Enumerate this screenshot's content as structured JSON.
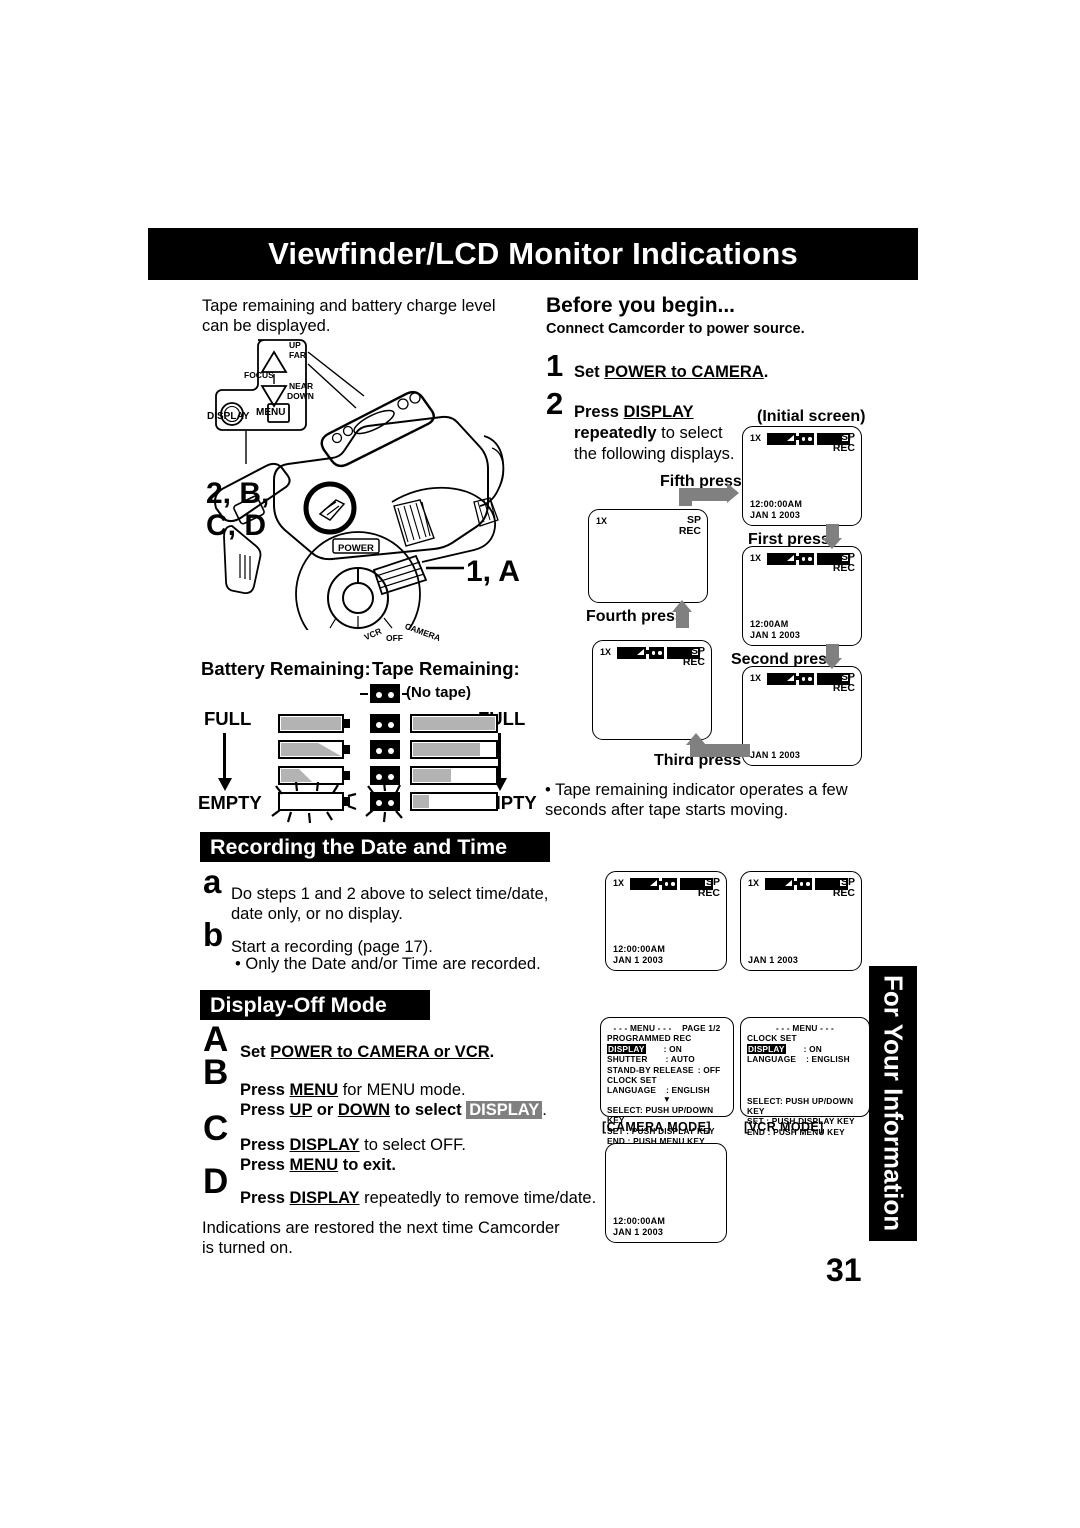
{
  "header": {
    "title": "Viewfinder/LCD Monitor Indications"
  },
  "intro": {
    "text": "Tape remaining and battery charge level can be displayed."
  },
  "before_you_begin": {
    "title": "Before you begin...",
    "subtitle": "Connect Camcorder to power source."
  },
  "steps": [
    {
      "num": "1",
      "lead": "Set ",
      "link": "POWER to CAMERA",
      "tail": "."
    },
    {
      "num": "2",
      "lead": "Press ",
      "link": "DISPLAY",
      "tail": "",
      "line2_bold": "repeatedly",
      "line2_rest": " to select",
      "line3": "the following displays."
    }
  ],
  "flow": {
    "initial_label": "(Initial screen)",
    "press_labels": {
      "first": "First press",
      "second": "Second press",
      "third": "Third press",
      "fourth": "Fourth press",
      "fifth": "Fifth press"
    },
    "screens": {
      "initial": {
        "zoom": "1X",
        "mode": "SP",
        "rec": "REC",
        "time": "12:00:00AM",
        "date": "JAN   1 2003",
        "icons": true
      },
      "first": {
        "zoom": "1X",
        "mode": "SP",
        "rec": "REC",
        "time": "12:00AM",
        "date": "JAN   1 2003",
        "icons": true
      },
      "second": {
        "zoom": "1X",
        "mode": "SP",
        "rec": "REC",
        "time": "",
        "date": "JAN   1 2003",
        "icons": true
      },
      "third": {
        "zoom": "1X",
        "mode": "SP",
        "rec": "REC",
        "time": "",
        "date": "",
        "icons": true
      },
      "fourth": {
        "zoom": "1X",
        "mode": "SP",
        "rec": "REC",
        "time": "",
        "date": "",
        "icons": false
      }
    }
  },
  "tape_note": "• Tape remaining indicator operates a few seconds after tape starts moving.",
  "camcorder": {
    "callout_left": "2, B,",
    "callout_left2": "C, D",
    "callout_right": "1, A",
    "controls": {
      "up": "UP",
      "far": "FAR",
      "focus": "FOCUS",
      "near": "NEAR",
      "down": "DOWN",
      "display": "DISPLAY",
      "menu": "MENU",
      "power": "POWER",
      "vcr": "VCR",
      "off": "OFF",
      "camera": "CAMERA"
    }
  },
  "remaining": {
    "battery_title": "Battery Remaining:",
    "tape_title": "Tape Remaining:",
    "no_tape": "(No tape)",
    "full_left": "FULL",
    "empty_left": "EMPTY",
    "full_right": "FULL",
    "empty_right": "EMPTY",
    "battery_levels": [
      100,
      62,
      30,
      0
    ],
    "tape_levels": [
      100,
      82,
      46,
      18,
      0
    ]
  },
  "recording_section": {
    "title": "Recording the Date and Time",
    "items": [
      {
        "letter": "a",
        "text": "Do steps 1 and 2 above to select time/date, date only, or no display."
      },
      {
        "letter": "b",
        "text": "Start a recording (page 17).",
        "bullet": "• Only the Date and/or Time are recorded."
      }
    ]
  },
  "display_off_section": {
    "title": "Display-Off Mode",
    "items": [
      {
        "letter": "A",
        "lead": "Set ",
        "link": "POWER to CAMERA or VCR",
        "tail": "."
      },
      {
        "letter": "B",
        "line1_lead": "Press ",
        "line1_link": "MENU",
        "line1_tail": " for MENU mode.",
        "line2_lead": "Press ",
        "line2_link1": "UP",
        "line2_mid": " or ",
        "line2_link2": "DOWN",
        "line2_tail": " to select ",
        "line2_box": "DISPLAY",
        "line2_end": "."
      },
      {
        "letter": "C",
        "line1_lead": "Press ",
        "line1_link": "DISPLAY",
        "line1_tail": " to select OFF.",
        "line2_lead": "Press ",
        "line2_link": "MENU",
        "line2_tail": " to exit."
      },
      {
        "letter": "D",
        "lead": "Press ",
        "link": "DISPLAY",
        "tail": " repeatedly to remove time/date."
      }
    ],
    "footnote": "Indications are restored the next time Camcorder is turned on."
  },
  "date_screens": [
    {
      "zoom": "1X",
      "mode": "SP",
      "rec": "REC",
      "time": "12:00:00AM",
      "date": "JAN   1 2003"
    },
    {
      "zoom": "1X",
      "mode": "SP",
      "rec": "REC",
      "time": "",
      "date": "JAN   1 2003"
    }
  ],
  "bottom_screen": {
    "time": "12:00:00AM",
    "date": "JAN   1 2003"
  },
  "menus": {
    "camera": {
      "title": "- - -  MENU  - - -",
      "page": "PAGE 1/2",
      "rows": [
        {
          "label": "PROGRAMMED  REC",
          "value": "",
          "selected": false
        },
        {
          "label": "DISPLAY",
          "value": ":  ON",
          "selected": true
        },
        {
          "label": "SHUTTER",
          "value": ":  AUTO",
          "selected": false
        },
        {
          "label": "STAND-BY RELEASE",
          "value": ":  OFF",
          "selected": false
        },
        {
          "label": "CLOCK SET",
          "value": "",
          "selected": false
        },
        {
          "label": "LANGUAGE",
          "value": ":  ENGLISH",
          "selected": false
        }
      ],
      "footer": [
        "SELECT: PUSH UP/DOWN KEY",
        "SET      :  PUSH DISPLAY KEY",
        "END      :  PUSH MENU KEY"
      ],
      "mode_label": "[CAMERA  MODE]"
    },
    "vcr": {
      "title": "- - -  MENU  - - -",
      "page": "",
      "rows": [
        {
          "label": "CLOCK  SET",
          "value": "",
          "selected": false
        },
        {
          "label": "DISPLAY",
          "value": ":  ON",
          "selected": true
        },
        {
          "label": "LANGUAGE",
          "value": ":  ENGLISH",
          "selected": false
        }
      ],
      "footer": [
        "SELECT:  PUSH UP/DOWN KEY",
        "SET      :  PUSH DISPLAY KEY",
        "END      :  PUSH MENU KEY"
      ],
      "mode_label": "[VCR  MODE]"
    }
  },
  "side_tab": {
    "text": "For Your Information"
  },
  "page_number": "31"
}
